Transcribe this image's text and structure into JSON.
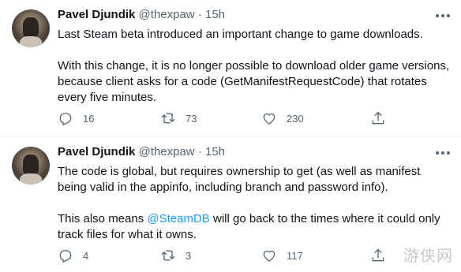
{
  "tweets": [
    {
      "name": "Pavel Djundik",
      "handle": "@thexpaw",
      "separator": "·",
      "time": "15h",
      "paragraph1": "Last Steam beta introduced an important change to game downloads.",
      "paragraph2": "With this change, it is no longer possible to download older game versions, because client asks for a code (GetManifestRequestCode) that rotates every five minutes.",
      "replies": "16",
      "retweets": "73",
      "likes": "230"
    },
    {
      "name": "Pavel Djundik",
      "handle": "@thexpaw",
      "separator": "·",
      "time": "15h",
      "paragraph1": "The code is global, but requires ownership to get (as well as manifest being valid in the appinfo, including branch and password info).",
      "paragraph2_before": "This also means ",
      "paragraph2_mention": "@SteamDB",
      "paragraph2_after": " will go back to the times where it could only track files for what it owns.",
      "replies": "4",
      "retweets": "3",
      "likes": "117"
    }
  ],
  "watermark": "游侠网"
}
